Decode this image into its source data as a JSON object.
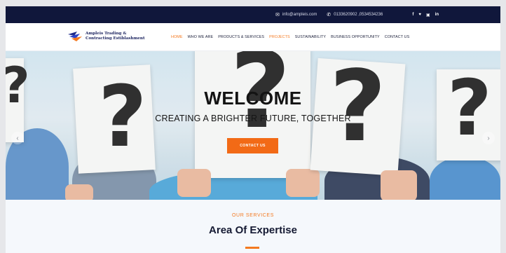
{
  "topbar": {
    "email_icon": "envelope-icon",
    "email": "info@ampleis.com",
    "phone_icon": "phone-icon",
    "phone": "0133620902 ,0534534236",
    "social": [
      {
        "icon": "facebook-icon",
        "glyph": "f"
      },
      {
        "icon": "twitter-icon",
        "glyph": "♥"
      },
      {
        "icon": "instagram-icon",
        "glyph": "▣"
      },
      {
        "icon": "linkedin-icon",
        "glyph": "in"
      }
    ]
  },
  "header": {
    "logo_line1": "Ampleis Trading &",
    "logo_line2": "Contracting Estiblashment",
    "nav": [
      {
        "label": "HOME",
        "active": true
      },
      {
        "label": "WHO WE ARE",
        "active": false
      },
      {
        "label": "PRODUCTS & SERVICES",
        "active": false
      },
      {
        "label": "PROJECTS",
        "active": true
      },
      {
        "label": "SUSTAINABILITY",
        "active": false
      },
      {
        "label": "BUSINESS OPPORTUNITY",
        "active": false
      },
      {
        "label": "CONTACT US",
        "active": false
      }
    ]
  },
  "hero": {
    "title": "WELCOME",
    "subtitle": "CREATING A BRIGHTER FUTURE, TOGETHER",
    "button": "CONTACT US",
    "prev_icon": "chevron-left-icon",
    "next_icon": "chevron-right-icon"
  },
  "services": {
    "label": "OUR SERVICES",
    "title": "Area Of Expertise"
  },
  "colors": {
    "topbar_bg": "#10173b",
    "accent": "#f47920",
    "button_bg": "#f26a16",
    "heading": "#151a33"
  }
}
